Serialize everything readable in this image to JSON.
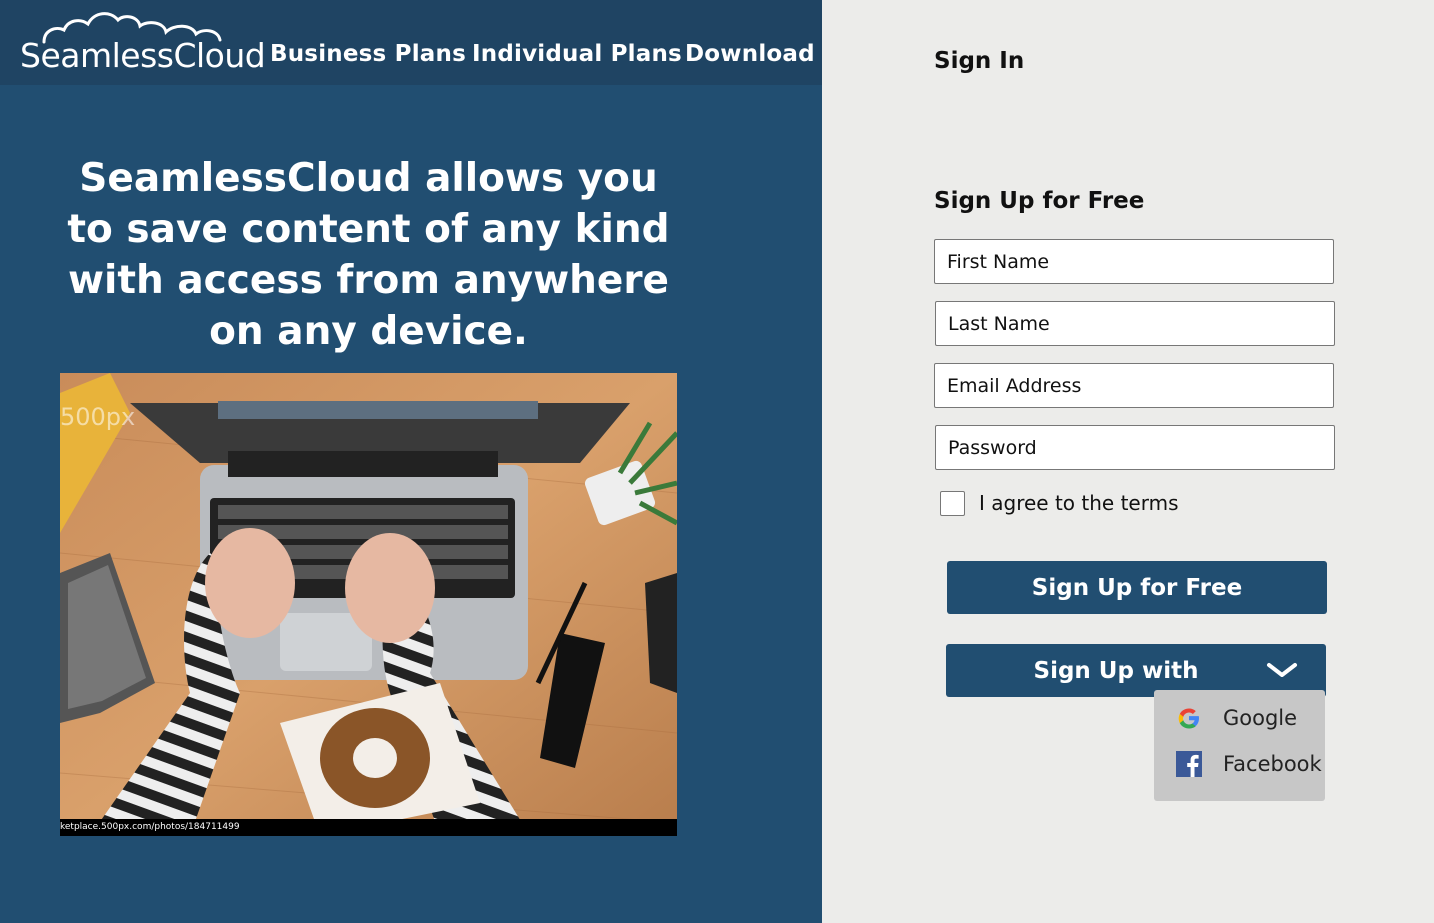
{
  "header": {
    "logo_text": "SeamlessCloud",
    "nav": [
      "Business Plans",
      "Individual Plans",
      "Download"
    ]
  },
  "hero": {
    "headline": "SeamlessCloud allows you to save content of any kind with access from anywhere on any device.",
    "photo_caption": "ketplace.500px.com/photos/184711499",
    "photo_watermark": "500px"
  },
  "signin": {
    "title": "Sign In"
  },
  "signup": {
    "title": "Sign Up for Free",
    "first_name_placeholder": "First Name",
    "last_name_placeholder": "Last Name",
    "email_placeholder": "Email Address",
    "password_placeholder": "Password",
    "agree_label": "I agree to the terms",
    "agree_checked": false,
    "submit_label": "Sign Up for Free",
    "with_label": "Sign Up with",
    "with_options": [
      {
        "label": "Google",
        "icon": "google-icon"
      },
      {
        "label": "Facebook",
        "icon": "facebook-icon"
      }
    ]
  },
  "colors": {
    "primary": "#214e71",
    "topbar": "#1f4463",
    "panel_bg": "#ececea",
    "dropdown_bg": "#c7c7c7"
  }
}
